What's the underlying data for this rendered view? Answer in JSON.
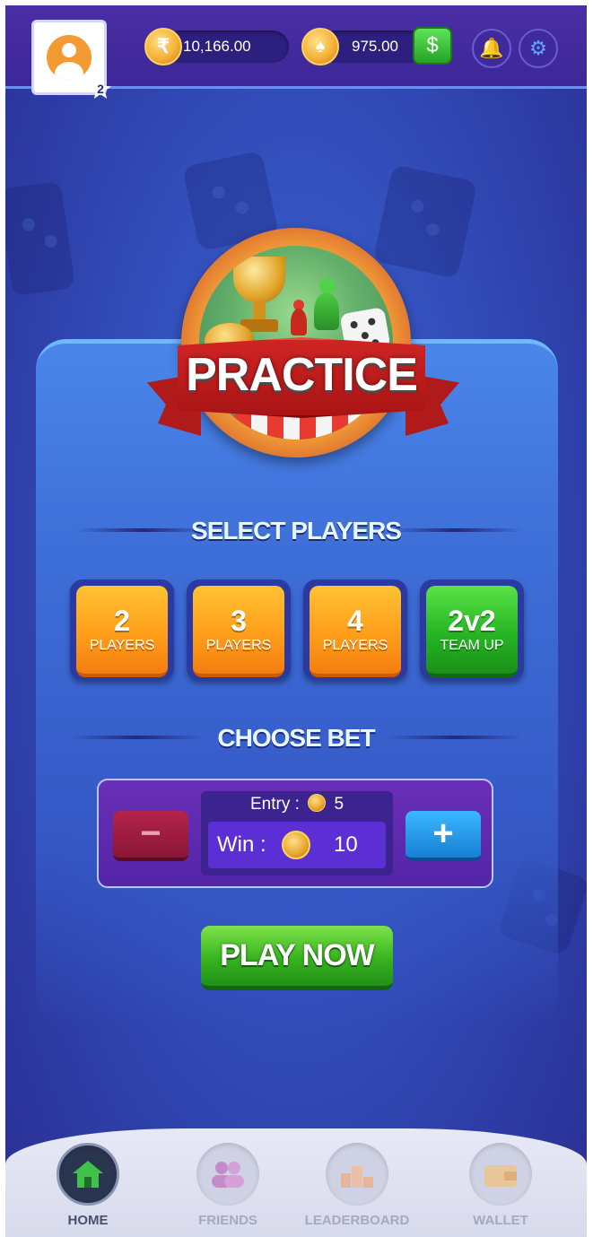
{
  "top_bar": {
    "level": "2",
    "rupee_symbol": "₹",
    "rupee_balance": "10,166.00",
    "chip_balance": "975.00",
    "cash_icon": "cash-hand-icon",
    "notification_icon": "bell-icon",
    "settings_icon": "gear-icon"
  },
  "badge": {
    "title": "PRACTICE"
  },
  "select_players": {
    "title": "SELECT PLAYERS",
    "options": [
      {
        "value": "2",
        "label": "PLAYERS"
      },
      {
        "value": "3",
        "label": "PLAYERS"
      },
      {
        "value": "4",
        "label": "PLAYERS"
      },
      {
        "value": "2v2",
        "label": "TEAM UP"
      }
    ]
  },
  "choose_bet": {
    "title": "CHOOSE BET",
    "entry_label": "Entry :",
    "entry_value": "5",
    "win_label": "Win :",
    "win_value": "10",
    "minus": "−",
    "plus": "+"
  },
  "play_button": "PLAY NOW",
  "bottom_nav": [
    {
      "label": "HOME",
      "icon": "home-icon",
      "active": true
    },
    {
      "label": "FRIENDS",
      "icon": "friends-icon"
    },
    {
      "label": "LEADERBOARD",
      "icon": "leaderboard-icon"
    },
    {
      "label": "WALLET",
      "icon": "wallet-icon"
    }
  ],
  "colors": {
    "background": "#3554c2",
    "top_bar": "#3c2798",
    "orange_button": "#ff9e1b",
    "green_button": "#27b524",
    "ribbon": "#b01a1a"
  }
}
